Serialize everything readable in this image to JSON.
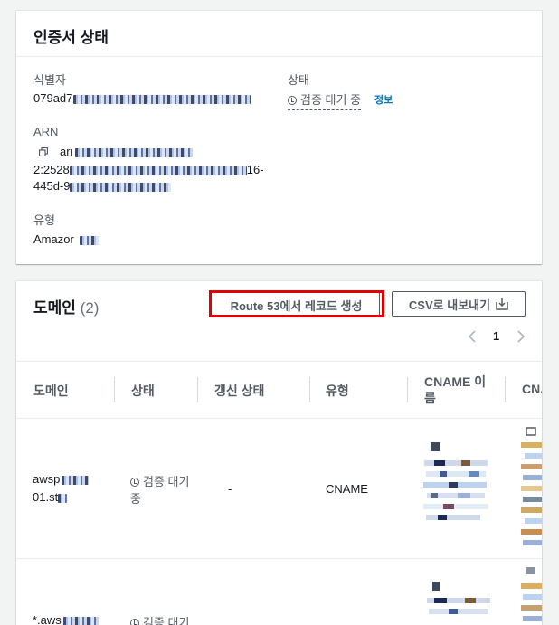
{
  "cert_card": {
    "title": "인증서 상태",
    "identifier_label": "식별자",
    "identifier_value": "079ad7",
    "status_label": "상태",
    "status_value": "검증 대기 중",
    "info_link": "정보",
    "arn_label": "ARN",
    "arn_line1": "arı",
    "arn_line2": "2:2528",
    "arn_line2_end": "16-",
    "arn_line3": "445d-9",
    "type_label": "유형",
    "type_value": "Amazor"
  },
  "domains_card": {
    "title": "도메인",
    "count": "(2)",
    "route53_button": "Route 53에서 레코드 생성",
    "csv_button": "CSV로 내보내기",
    "page_number": "1",
    "columns": [
      "도메인",
      "상태",
      "갱신 상태",
      "유형",
      "CNAME 이름",
      "CNA"
    ],
    "rows": [
      {
        "domain_line1": "awsp",
        "domain_line2": "01.st",
        "status_line1": "검증 대기",
        "status_line2": "중",
        "renewal": "-",
        "type": "CNAME"
      },
      {
        "domain_line1": "*.aws",
        "status_line1": "검증 대기"
      }
    ]
  },
  "colors": {
    "highlight": "#e00000",
    "link": "#0073bb"
  },
  "icons": [
    "copy-icon",
    "clock-icon",
    "download-icon",
    "chevron-left-icon",
    "chevron-right-icon"
  ]
}
